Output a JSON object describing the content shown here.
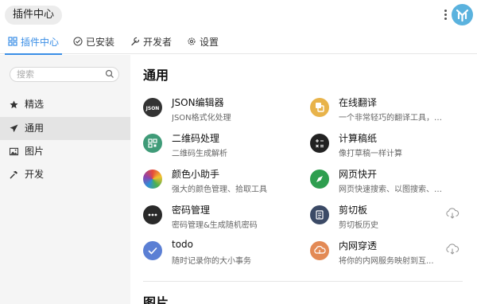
{
  "app": {
    "title": "插件中心"
  },
  "tabs": [
    {
      "label": "插件中心",
      "icon": "grid-icon"
    },
    {
      "label": "已安装",
      "icon": "check-circle-icon"
    },
    {
      "label": "开发者",
      "icon": "wrench-icon"
    },
    {
      "label": "设置",
      "icon": "gear-icon"
    }
  ],
  "sidebar": {
    "search_placeholder": "搜索",
    "items": [
      {
        "label": "精选",
        "icon": "star-icon"
      },
      {
        "label": "通用",
        "icon": "paper-plane-icon"
      },
      {
        "label": "图片",
        "icon": "image-icon"
      },
      {
        "label": "开发",
        "icon": "hammer-icon"
      }
    ]
  },
  "main": {
    "section_title": "通用",
    "next_section_title": "图片",
    "plugins": [
      {
        "name": "JSON编辑器",
        "desc": "JSON格式化处理",
        "icon": "json-icon",
        "color": "#333333"
      },
      {
        "name": "在线翻译",
        "desc": "一个非常轻巧的翻译工具，不巧...",
        "icon": "translate-icon",
        "color": "#e8b34a"
      },
      {
        "name": "二维码处理",
        "desc": "二维码生成解析",
        "icon": "qrcode-icon",
        "color": "#3f9b78"
      },
      {
        "name": "计算稿纸",
        "desc": "像打草稿一样计算",
        "icon": "calculator-icon",
        "color": "#222222"
      },
      {
        "name": "颜色小助手",
        "desc": "强大的颜色管理、拾取工具",
        "icon": "color-wheel-icon",
        "color": "#e44a3c"
      },
      {
        "name": "网页快开",
        "desc": "网页快速搜索、以图搜索、移动...",
        "icon": "compass-icon",
        "color": "#2e9e4f"
      },
      {
        "name": "密码管理",
        "desc": "密码管理&生成随机密码",
        "icon": "password-icon",
        "color": "#2a2a2a"
      },
      {
        "name": "剪切板",
        "desc": "剪切板历史",
        "icon": "clipboard-icon",
        "color": "#3b4a66"
      },
      {
        "name": "todo",
        "desc": "随时记录你的大小事务",
        "icon": "check-icon",
        "color": "#5b7fd4"
      },
      {
        "name": "内网穿透",
        "desc": "将你的内网服务映射到互...",
        "icon": "tunnel-icon",
        "color": "#e38a55"
      }
    ]
  },
  "colors": {
    "accent": "#3a8ee6",
    "avatar": "#5ab2de"
  }
}
